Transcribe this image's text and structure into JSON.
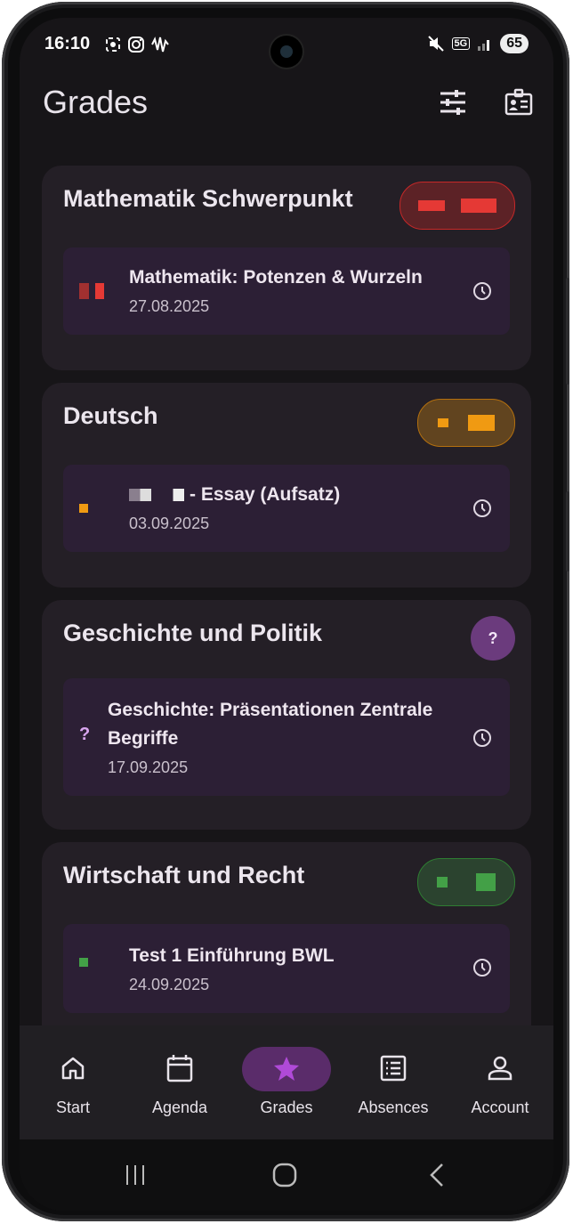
{
  "status": {
    "time": "16:10",
    "network": "5G",
    "battery": "65"
  },
  "header": {
    "title": "Grades"
  },
  "subjects": [
    {
      "name": "Mathematik Schwerpunkt",
      "badge_color": "#c62828",
      "exams": [
        {
          "name": "Mathematik: Potenzen & Wurzeln",
          "date": "27.08.2025",
          "grade_color": "#e53935"
        }
      ]
    },
    {
      "name": "Deutsch",
      "badge_color": "#f09a12",
      "exams": [
        {
          "name": "- Essay (Aufsatz)",
          "date": "03.09.2025",
          "grade_color": "#f09a12"
        }
      ]
    },
    {
      "name": "Geschichte und Politik",
      "badge": "?",
      "badge_color": "#6b3b7d",
      "exams": [
        {
          "name": "Geschichte: Präsentationen Zentrale Begriffe",
          "date": "17.09.2025",
          "grade": "?",
          "grade_color": "#d9a6f0"
        }
      ]
    },
    {
      "name": "Wirtschaft und Recht",
      "badge_color": "#3fae4a",
      "exams": [
        {
          "name": "Test 1 Einführung BWL",
          "date": "24.09.2025",
          "grade_color": "#43a047"
        }
      ]
    }
  ],
  "nav": [
    {
      "label": "Start",
      "icon": "home-icon"
    },
    {
      "label": "Agenda",
      "icon": "calendar-icon"
    },
    {
      "label": "Grades",
      "icon": "star-icon",
      "active": true
    },
    {
      "label": "Absences",
      "icon": "list-icon"
    },
    {
      "label": "Account",
      "icon": "person-icon"
    }
  ],
  "colors": {
    "accent": "#9c3ec4",
    "active_pill": "#5a2c6a",
    "card_bg": "#241f26",
    "item_bg": "#2c1f35"
  }
}
